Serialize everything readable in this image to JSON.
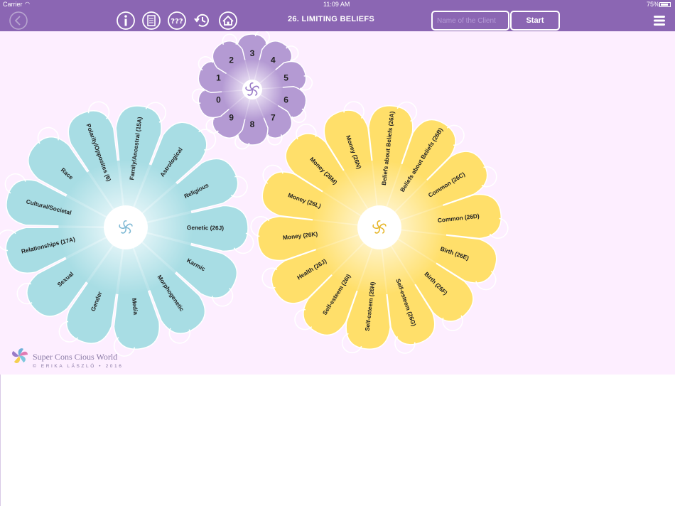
{
  "status_bar": {
    "carrier": "Carrier",
    "time": "11:09 AM",
    "battery": "75%"
  },
  "header": {
    "title": "26. LIMITING BELIEFS",
    "client_placeholder": "Name of the Client",
    "start_label": "Start",
    "help_label": "???"
  },
  "brand": {
    "name": "Super Cons Cious World",
    "copyright": "© ERIKA LÁSZLÓ • 2016"
  },
  "colors": {
    "nav": "#8b66b3",
    "background": "#fdeeff",
    "petal_blue": "#a8dde4",
    "petal_yellow": "#ffdf6a",
    "petal_purple": "#b49ad3"
  },
  "number_wheel": {
    "labels": [
      "3",
      "4",
      "5",
      "6",
      "7",
      "8",
      "9",
      "0",
      "1",
      "2"
    ]
  },
  "blue_wheel": {
    "labels": [
      "Family/Ancestral (15A)",
      "Astrological",
      "Religious",
      "Genetic (26J)",
      "Karmic",
      "Morphogenetic",
      "Media",
      "Gender",
      "Sexual",
      "Relationships (17A)",
      "Cultural/Societal",
      "Race",
      "Polarity/Opposites (6)"
    ]
  },
  "yellow_wheel": {
    "labels": [
      "Beliefs about Beliefs (26A)",
      "Beliefs about Beliefs (26B)",
      "Common (26C)",
      "Common (26D)",
      "Birth (26E)",
      "Birth (26F)",
      "Self-esteem (26G)",
      "Self-esteem (26H)",
      "Self-esteem (26I)",
      "Health (26J)",
      "Money (26K)",
      "Money (26L)",
      "Money (26M)",
      "Money (26N)"
    ]
  }
}
